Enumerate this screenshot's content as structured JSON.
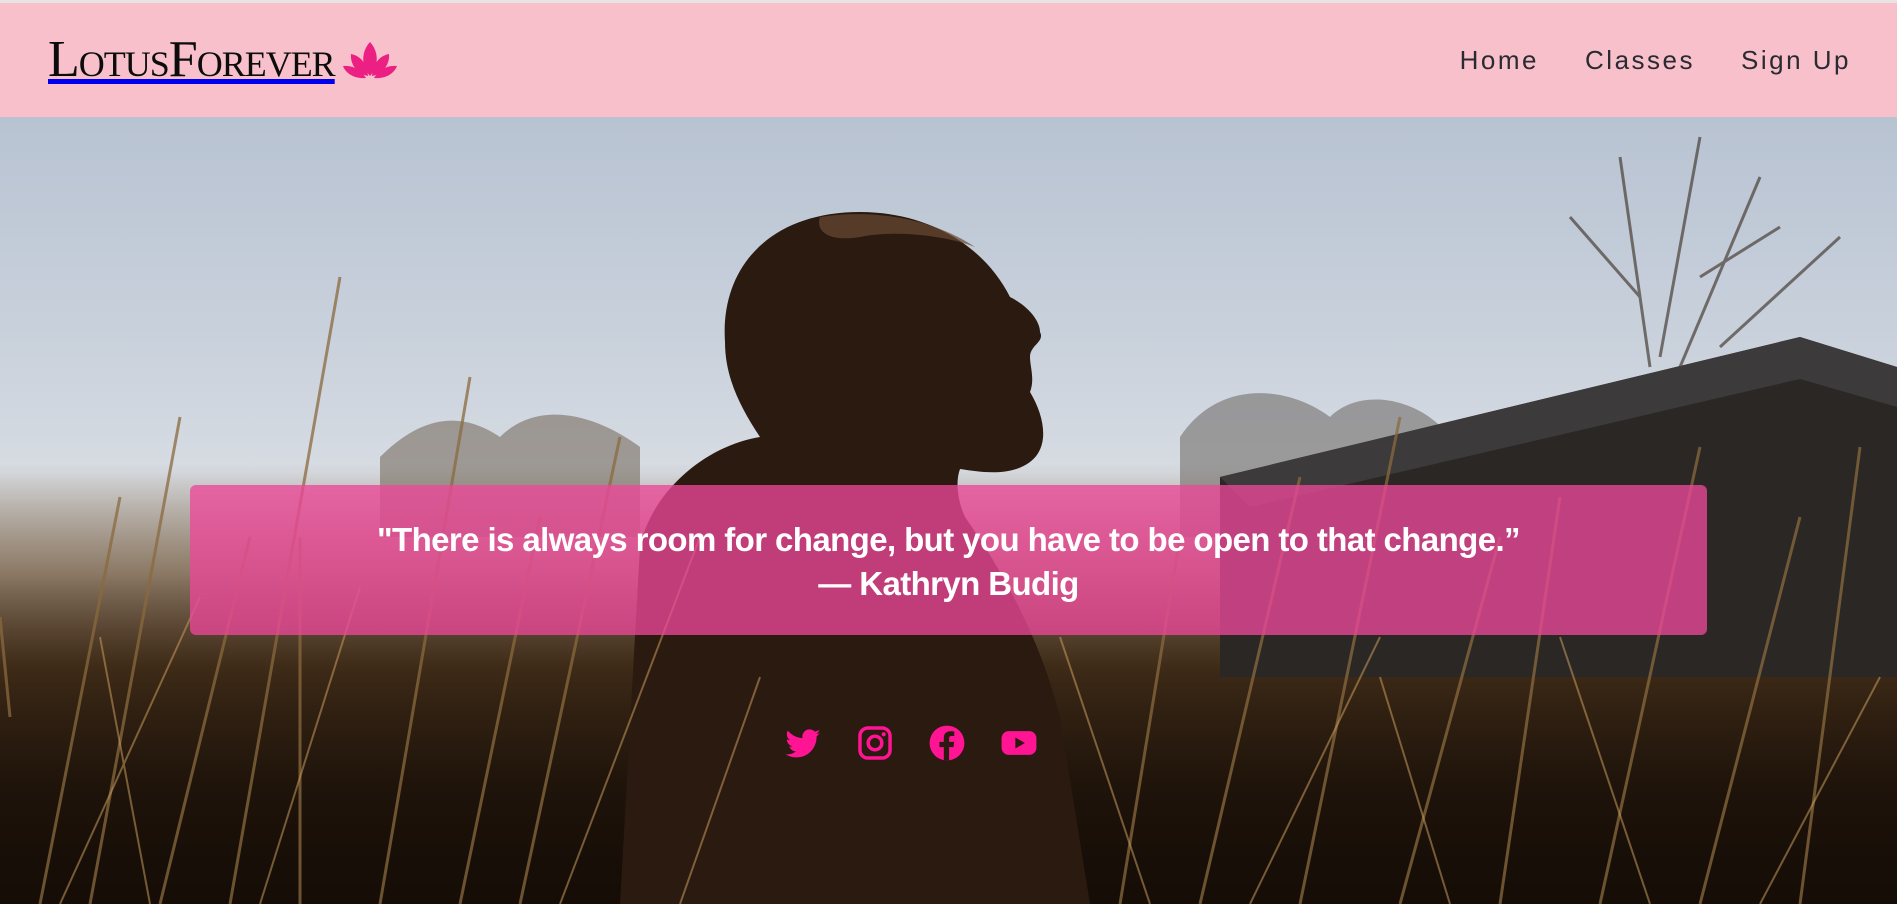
{
  "brand": {
    "name": "LotusForever",
    "logo_icon": "lotus-icon",
    "colors": {
      "text": "#0c0c0c",
      "icon": "#ec1f82"
    }
  },
  "nav": {
    "items": [
      {
        "label": "Home"
      },
      {
        "label": "Classes"
      },
      {
        "label": "Sign Up"
      }
    ]
  },
  "hero": {
    "quote": "\"There is always room for change, but you have to be open to that change.”",
    "author": "— Kathryn Budig",
    "quote_box_color": "#ec4899"
  },
  "socials": [
    {
      "name": "twitter-icon"
    },
    {
      "name": "instagram-icon"
    },
    {
      "name": "facebook-icon"
    },
    {
      "name": "youtube-icon"
    }
  ],
  "colors": {
    "header_bg": "#f7c0ca",
    "accent": "#ff1493",
    "nav_text": "#2a2a33"
  }
}
